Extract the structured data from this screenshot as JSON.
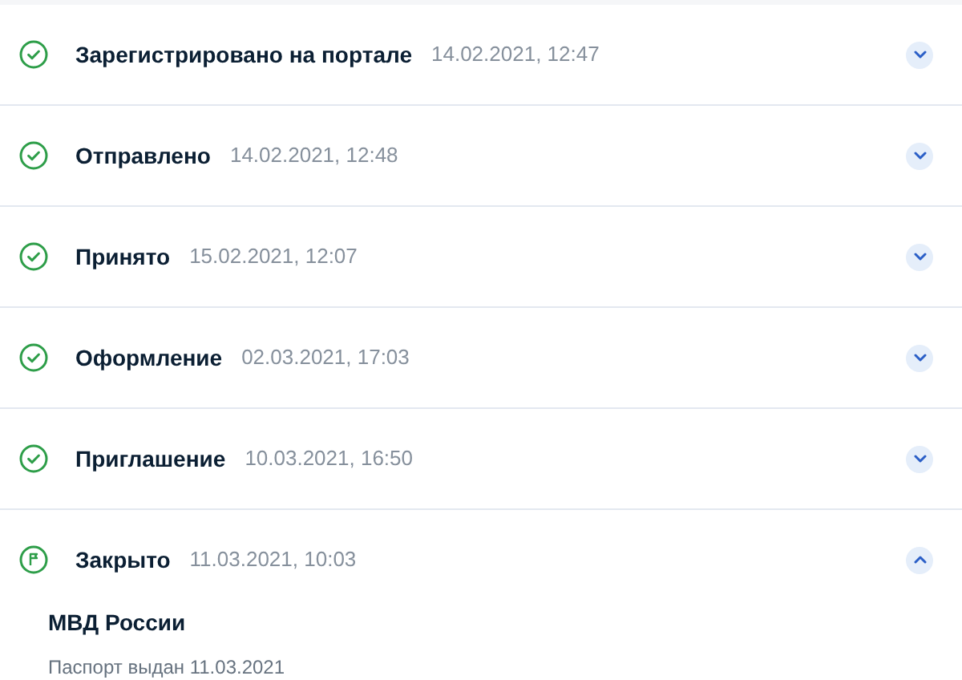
{
  "steps": [
    {
      "kind": "done",
      "title": "Зарегистрировано на портале",
      "time": "14.02.2021, 12:47",
      "expanded": false
    },
    {
      "kind": "done",
      "title": "Отправлено",
      "time": "14.02.2021, 12:48",
      "expanded": false
    },
    {
      "kind": "done",
      "title": "Принято",
      "time": "15.02.2021, 12:07",
      "expanded": false
    },
    {
      "kind": "done",
      "title": "Оформление",
      "time": "02.03.2021, 17:03",
      "expanded": false
    },
    {
      "kind": "done",
      "title": "Приглашение",
      "time": "10.03.2021, 16:50",
      "expanded": false
    },
    {
      "kind": "closed",
      "title": "Закрыто",
      "time": "11.03.2021, 10:03",
      "expanded": true,
      "details": {
        "title": "МВД России",
        "text": "Паспорт выдан 11.03.2021"
      }
    }
  ]
}
